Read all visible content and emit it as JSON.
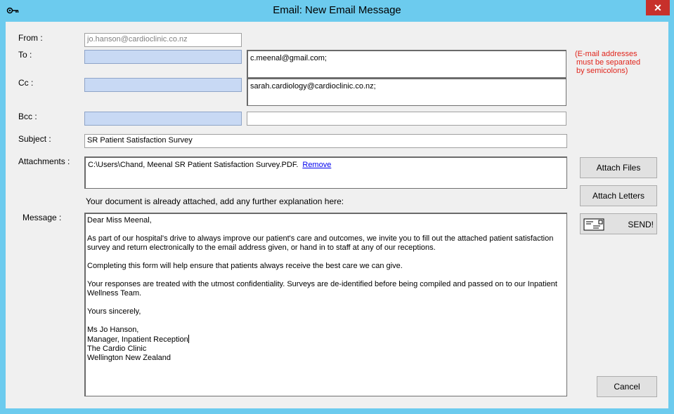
{
  "window": {
    "title": "Email: New Email Message",
    "close_glyph": "✕"
  },
  "labels": {
    "from": "From :",
    "to": "To :",
    "cc": "Cc :",
    "bcc": "Bcc :",
    "subject": "Subject :",
    "attachments": "Attachments :",
    "message": "Message :"
  },
  "fields": {
    "from_value": "jo.hanson@cardioclinic.co.nz",
    "to_value": "c.meenal@gmail.com;",
    "cc_value": "sarah.cardiology@cardioclinic.co.nz;",
    "bcc_value": "",
    "subject_value": "SR Patient Satisfaction Survey"
  },
  "attachments": {
    "file": "C:\\Users\\Chand, Meenal SR Patient Satisfaction Survey.PDF.",
    "remove_label": "Remove"
  },
  "note": {
    "line1": "(E-mail addresses",
    "line2": "must be separated",
    "line3": "by semicolons)"
  },
  "hint": "Your document is already attached, add any further explanation here:",
  "message": {
    "greeting": "Dear Miss Meenal,",
    "para1": "As part of our hospital's drive to always improve our patient's care and outcomes, we invite you to fill out the attached patient satisfaction survey and return electronically to the email address given, or hand in to staff at any of our receptions.",
    "para2": "Completing this form will help ensure that patients always receive the best care we can give.",
    "para3": "Your responses are treated with the utmost confidentiality. Surveys are de-identified before being compiled and passed on to our Inpatient Wellness Team.",
    "closing": "Yours sincerely,",
    "sig1": "Ms Jo Hanson,",
    "sig2": "Manager, Inpatient Reception",
    "sig3": "The Cardio Clinic",
    "sig4": "Wellington New Zealand"
  },
  "buttons": {
    "attach_files": "Attach Files",
    "attach_letters": "Attach Letters",
    "send": "SEND!",
    "cancel": "Cancel"
  },
  "icons": {
    "title": "key-icon",
    "send": "envelope-icon"
  },
  "colors": {
    "titlebar": "#6ccbee",
    "close": "#c7302b",
    "address_button": "#c8d9f4",
    "note": "#e0251c",
    "link": "#0000ee"
  }
}
